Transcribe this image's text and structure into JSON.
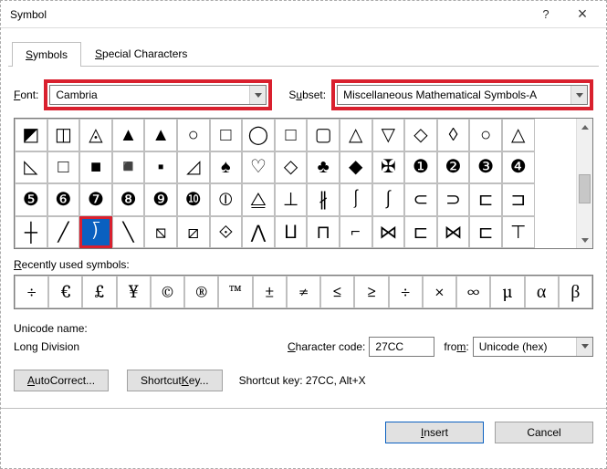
{
  "titlebar": {
    "title": "Symbol",
    "help": "?",
    "close": "×"
  },
  "tabs": {
    "symbols": "Symbols",
    "special": "Special Characters"
  },
  "fields": {
    "font_label_u": "F",
    "font_label": "ont:",
    "font_value": "Cambria",
    "subset_label_u": "u",
    "subset_prefix": "S",
    "subset_suffix": "bset:",
    "subset_value": "Miscellaneous Mathematical Symbols-A"
  },
  "grid": {
    "rows": [
      [
        "◩",
        "◫",
        "◬",
        "▲",
        "▲",
        "○",
        "□",
        "◯",
        "□",
        "▢",
        "△",
        "▽",
        "◇",
        "◊",
        "○",
        "△"
      ],
      [
        "◺",
        "□",
        "■",
        "◾",
        "▪",
        "◿",
        "♠",
        "♡",
        "◇",
        "♣",
        "◆",
        "✠",
        "❶",
        "❷",
        "❸",
        "❹"
      ],
      [
        "❺",
        "❻",
        "❼",
        "❽",
        "❾",
        "❿",
        "⦶",
        "⧋",
        "⊥",
        "∦",
        "⎰",
        "∫",
        "⊂",
        "⊃",
        "⊏",
        "⊐"
      ],
      [
        "┼",
        "╱",
        "⟌",
        "╲",
        "⧅",
        "⧄",
        "⟐",
        "⋀",
        "⨿",
        "⊓",
        "⌐",
        "⋈",
        "⊏",
        "⋈",
        "⊏",
        "⊤"
      ]
    ],
    "selected_row": 3,
    "selected_col": 2
  },
  "recents": {
    "label_u": "R",
    "label": "ecently used symbols:",
    "items": [
      "÷",
      "€",
      "£",
      "¥",
      "©",
      "®",
      "™",
      "±",
      "≠",
      "≤",
      "≥",
      "÷",
      "×",
      "∞",
      "µ",
      "α",
      "β"
    ]
  },
  "unicode": {
    "label": "Unicode name:",
    "name": "Long Division",
    "code_label_u": "C",
    "code_label": "haracter code:",
    "code_value": "27CC",
    "from_label_u": "m",
    "from_prefix": "fro",
    "from_suffix": ":",
    "from_value": "Unicode (hex)"
  },
  "buttons": {
    "autocorrect_u": "A",
    "autocorrect": "utoCorrect...",
    "shortcut_u": "K",
    "shortcut_pre": "Shortcut ",
    "shortcut_suf": "ey...",
    "shortcut_text": "Shortcut key: 27CC, Alt+X",
    "insert_u": "I",
    "insert": "nsert",
    "cancel": "Cancel"
  }
}
